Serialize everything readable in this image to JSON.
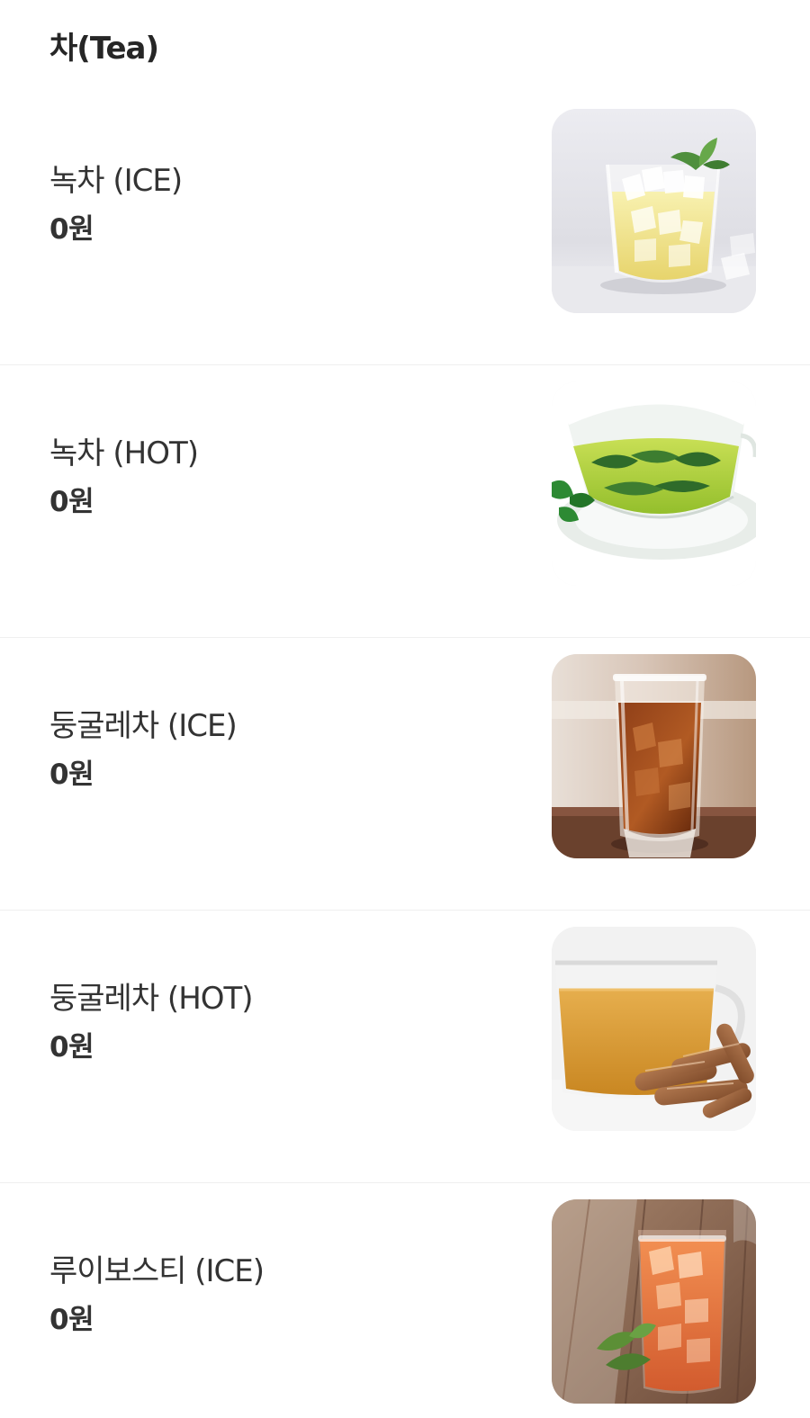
{
  "section": {
    "title": "차(Tea)"
  },
  "items": [
    {
      "name": "녹차 (ICE)",
      "price": "0원"
    },
    {
      "name": "녹차 (HOT)",
      "price": "0원"
    },
    {
      "name": "둥굴레차 (ICE)",
      "price": "0원"
    },
    {
      "name": "둥굴레차 (HOT)",
      "price": "0원"
    },
    {
      "name": "루이보스티 (ICE)",
      "price": "0원"
    }
  ]
}
